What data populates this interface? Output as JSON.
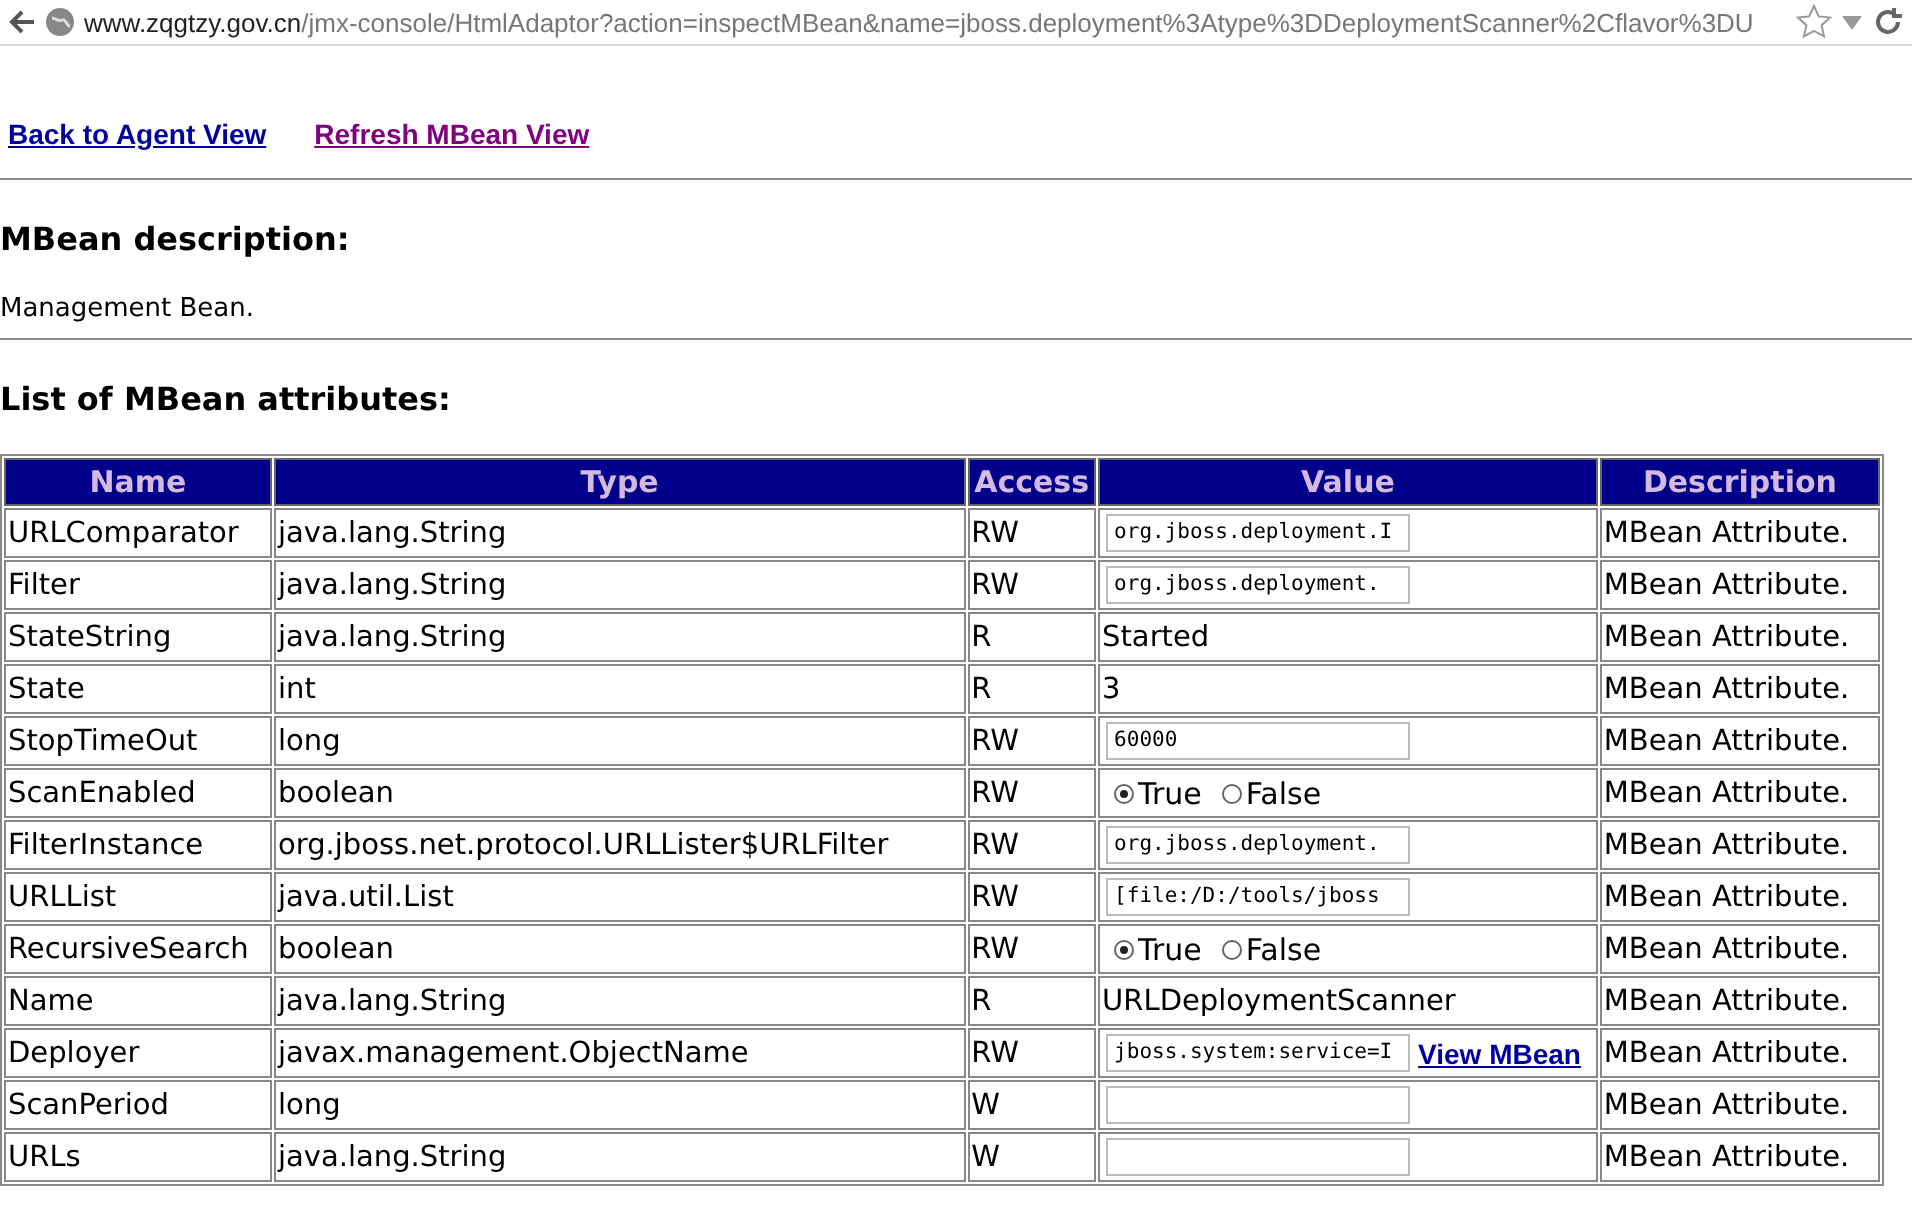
{
  "browser": {
    "url_host": "www.zqgtzy.gov.cn",
    "url_path": "/jmx-console/HtmlAdaptor?action=inspectMBean&name=jboss.deployment%3Atype%3DDeploymentScanner%2Cflavor%3DU"
  },
  "links": [
    {
      "label": "Back to Agent View",
      "visited": false
    },
    {
      "label": "Refresh MBean View",
      "visited": true
    }
  ],
  "description_heading": "MBean description:",
  "description": "Management Bean.",
  "attributes_heading": "List of MBean attributes:",
  "table": {
    "columns": [
      "Name",
      "Type",
      "Access",
      "Value",
      "Description"
    ],
    "rows": [
      {
        "name": "URLComparator",
        "type": "java.lang.String",
        "access": "RW",
        "value": {
          "kind": "input",
          "text": "org.jboss.deployment.I"
        },
        "description": "MBean Attribute."
      },
      {
        "name": "Filter",
        "type": "java.lang.String",
        "access": "RW",
        "value": {
          "kind": "input",
          "text": "org.jboss.deployment."
        },
        "description": "MBean Attribute."
      },
      {
        "name": "StateString",
        "type": "java.lang.String",
        "access": "R",
        "value": {
          "kind": "text",
          "text": "Started"
        },
        "description": "MBean Attribute."
      },
      {
        "name": "State",
        "type": "int",
        "access": "R",
        "value": {
          "kind": "text",
          "text": "3"
        },
        "description": "MBean Attribute."
      },
      {
        "name": "StopTimeOut",
        "type": "long",
        "access": "RW",
        "value": {
          "kind": "input",
          "text": "60000"
        },
        "description": "MBean Attribute."
      },
      {
        "name": "ScanEnabled",
        "type": "boolean",
        "access": "RW",
        "value": {
          "kind": "radio",
          "options": [
            {
              "label": "True",
              "selected": true
            },
            {
              "label": "False",
              "selected": false
            }
          ]
        },
        "description": "MBean Attribute."
      },
      {
        "name": "FilterInstance",
        "type": "org.jboss.net.protocol.URLLister$URLFilter",
        "access": "RW",
        "value": {
          "kind": "input",
          "text": "org.jboss.deployment."
        },
        "description": "MBean Attribute."
      },
      {
        "name": "URLList",
        "type": "java.util.List",
        "access": "RW",
        "value": {
          "kind": "input",
          "text": "[file:/D:/tools/jboss"
        },
        "description": "MBean Attribute."
      },
      {
        "name": "RecursiveSearch",
        "type": "boolean",
        "access": "RW",
        "value": {
          "kind": "radio",
          "options": [
            {
              "label": "True",
              "selected": true
            },
            {
              "label": "False",
              "selected": false
            }
          ]
        },
        "description": "MBean Attribute."
      },
      {
        "name": "Name",
        "type": "java.lang.String",
        "access": "R",
        "value": {
          "kind": "text",
          "text": "URLDeploymentScanner"
        },
        "description": "MBean Attribute."
      },
      {
        "name": "Deployer",
        "type": "javax.management.ObjectName",
        "access": "RW",
        "value": {
          "kind": "input_link",
          "text": "jboss.system:service=I",
          "link": "View MBean"
        },
        "description": "MBean Attribute."
      },
      {
        "name": "ScanPeriod",
        "type": "long",
        "access": "W",
        "value": {
          "kind": "input"
        },
        "description": "MBean Attribute."
      },
      {
        "name": "URLs",
        "type": "java.lang.String",
        "access": "W",
        "value": {
          "kind": "input"
        },
        "description": "MBean Attribute."
      }
    ]
  }
}
